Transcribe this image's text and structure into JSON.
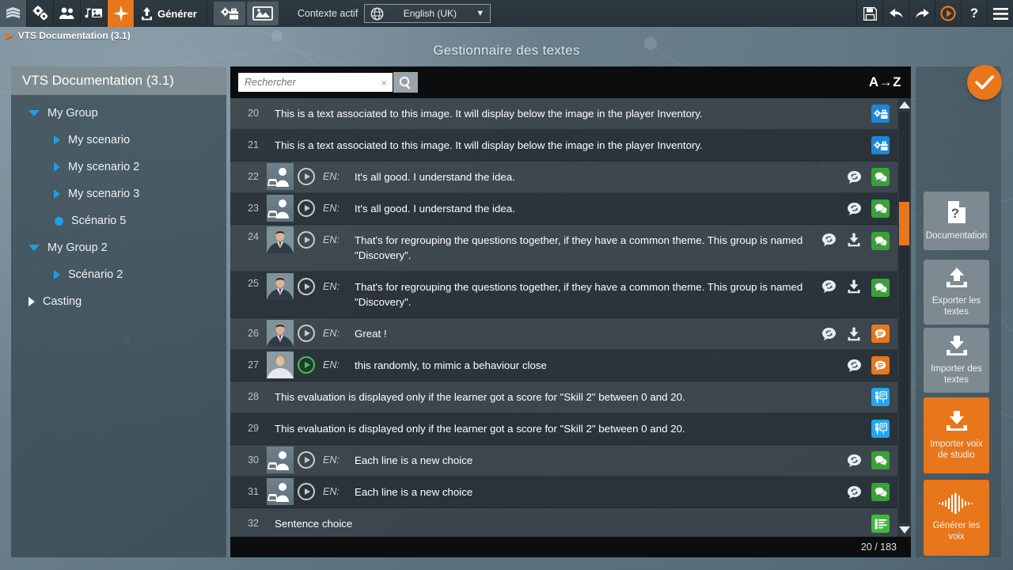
{
  "toolbar": {
    "buttons": [
      {
        "name": "scenario-icon",
        "label": "Scénario"
      },
      {
        "name": "settings-icon",
        "label": "Paramètres"
      },
      {
        "name": "characters-icon",
        "label": "Personnages"
      },
      {
        "name": "media-icon",
        "label": "Médias"
      },
      {
        "name": "spark-icon",
        "label": "Textes"
      }
    ],
    "generate_label": "Générer",
    "tool_buttons": [
      {
        "name": "toolbox-icon",
        "label": "Boîte à outils"
      },
      {
        "name": "screen-icon",
        "label": "Écran"
      }
    ],
    "context_label": "Contexte actif",
    "language_value": "English (UK)",
    "right_buttons": [
      {
        "name": "save-icon",
        "label": "Enregistrer"
      },
      {
        "name": "undo-icon",
        "label": "Annuler"
      },
      {
        "name": "redo-icon",
        "label": "Rétablir"
      },
      {
        "name": "play-icon",
        "label": "Prévisualiser"
      },
      {
        "name": "help-icon",
        "label": "?"
      },
      {
        "name": "menu-icon",
        "label": "Menu"
      }
    ]
  },
  "breadcrumb": "VTS Documentation (3.1)",
  "page_title": "Gestionnaire des textes",
  "sidebar": {
    "title": "VTS Documentation (3.1)",
    "items": [
      {
        "label": "My Group",
        "level": 0,
        "marker": "caret-down"
      },
      {
        "label": "My scenario",
        "level": 1,
        "marker": "caret-right"
      },
      {
        "label": "My scenario 2",
        "level": 1,
        "marker": "caret-right"
      },
      {
        "label": "My scenario 3",
        "level": 1,
        "marker": "caret-right"
      },
      {
        "label": "Scénario 5",
        "level": 1,
        "marker": "dot"
      },
      {
        "label": "My Group 2",
        "level": 0,
        "marker": "caret-down"
      },
      {
        "label": "Scénario 2",
        "level": 1,
        "marker": "caret-right"
      },
      {
        "label": "Casting",
        "level": 0,
        "marker": "caret-right-white"
      }
    ]
  },
  "search": {
    "value": "",
    "placeholder": "Rechercher",
    "clear_label": "×",
    "sort_label": "A→Z"
  },
  "list": {
    "rows": [
      {
        "num": "20",
        "type": "plain",
        "text": "This is a text associated to this image. It will display below the image in the player Inventory.",
        "badges": [
          "toolbox-blue"
        ]
      },
      {
        "num": "21",
        "type": "plain",
        "text": "This is a text associated to this image. It will display below the image in the player Inventory.",
        "badges": [
          "toolbox-blue"
        ]
      },
      {
        "num": "22",
        "type": "voice",
        "avatar": "silhouette",
        "lang": "EN:",
        "text": "It's all good. I understand the idea.",
        "play": "off",
        "icons": [
          "sync-bubble"
        ],
        "badges": [
          "green-bubbles"
        ]
      },
      {
        "num": "23",
        "type": "voice",
        "avatar": "silhouette",
        "lang": "EN:",
        "text": "It's all good. I understand the idea.",
        "play": "off",
        "icons": [
          "sync-bubble"
        ],
        "badges": [
          "green-bubbles"
        ]
      },
      {
        "num": "24",
        "type": "voice",
        "avatar": "man",
        "lang": "EN:",
        "text": "That's for regrouping the questions together, if they have a common theme. This group is named \"Discovery\".",
        "play": "off",
        "icons": [
          "sync-bubble",
          "download"
        ],
        "badges": [
          "green-bubbles"
        ],
        "tall": true
      },
      {
        "num": "25",
        "type": "voice",
        "avatar": "man",
        "lang": "EN:",
        "text": "That's for regrouping the questions together, if they have a common theme. This group is named \"Discovery\".",
        "play": "off",
        "icons": [
          "sync-bubble",
          "download"
        ],
        "badges": [
          "green-bubbles"
        ],
        "tall": true
      },
      {
        "num": "26",
        "type": "voice",
        "avatar": "man",
        "lang": "EN:",
        "text": "Great !",
        "play": "off",
        "icons": [
          "sync-bubble",
          "download"
        ],
        "badges": [
          "orange-bubble"
        ]
      },
      {
        "num": "27",
        "type": "voice",
        "avatar": "woman",
        "lang": "EN:",
        "text": "this randomly, to mimic a behaviour close",
        "play": "on",
        "icons": [
          "sync-bubble"
        ],
        "badges": [
          "orange-bubble"
        ]
      },
      {
        "num": "28",
        "type": "plain",
        "text": "This evaluation is displayed only if the learner got a score for \"Skill 2\" between 0 and 20.",
        "badges": [
          "trainer-blue"
        ]
      },
      {
        "num": "29",
        "type": "plain",
        "text": "This evaluation is displayed only if the learner got a score for \"Skill 2\" between 0 and 20.",
        "badges": [
          "trainer-blue"
        ]
      },
      {
        "num": "30",
        "type": "voice",
        "avatar": "silhouette",
        "lang": "EN:",
        "text": "Each line is a new choice",
        "play": "off",
        "icons": [
          "sync-bubble"
        ],
        "badges": [
          "green-bubbles"
        ]
      },
      {
        "num": "31",
        "type": "voice",
        "avatar": "silhouette",
        "lang": "EN:",
        "text": "Each line is a new choice",
        "play": "off",
        "icons": [
          "sync-bubble"
        ],
        "badges": [
          "green-bubbles"
        ]
      },
      {
        "num": "32",
        "type": "plain",
        "text": "Sentence choice",
        "badges": [
          "list-green"
        ]
      }
    ],
    "counter": "20 / 183"
  },
  "rightbar": {
    "validate_label": "Valider",
    "buttons": [
      {
        "name": "documentation-button",
        "label": "Documentation",
        "icon": "question-doc-icon",
        "style": "grey"
      },
      {
        "name": "export-texts-button",
        "label": "Exporter les\ntextes",
        "icon": "upload-icon",
        "style": "grey"
      },
      {
        "name": "import-texts-button",
        "label": "Importer des\ntextes",
        "icon": "download-icon",
        "style": "grey"
      },
      {
        "name": "import-studio-voice-button",
        "label": "Importer voix\nde studio",
        "icon": "download-icon",
        "style": "orange"
      },
      {
        "name": "generate-voices-button",
        "label": "Générer les\nvoix",
        "icon": "waveform-icon",
        "style": "orange"
      }
    ]
  },
  "colors": {
    "accent": "#e8761a",
    "blue": "#1e9ee8",
    "green": "#3aa137",
    "dark": "#0b0d0f"
  }
}
